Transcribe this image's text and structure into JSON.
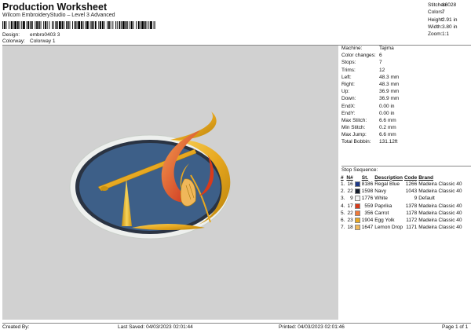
{
  "header": {
    "title": "Production Worksheet",
    "subtitle": "Wilcom EmbroideryStudio – Level 3 Advanced",
    "design_label": "Design:",
    "design_value": "embro0403 3",
    "colorway_label": "Colorway:",
    "colorway_value": "Colorway 1"
  },
  "summary": [
    {
      "label": "Stitches:",
      "value": "16028"
    },
    {
      "label": "Colors:",
      "value": "7"
    },
    {
      "label": "Height:",
      "value": "2.91 in"
    },
    {
      "label": "Width:",
      "value": "3.80 in"
    },
    {
      "label": "Zoom:",
      "value": "1:1"
    }
  ],
  "machine_info": [
    {
      "label": "Machine:",
      "value": "Tajima"
    },
    {
      "label": "Color changes:",
      "value": "6"
    },
    {
      "label": "Stops:",
      "value": "7"
    },
    {
      "label": "Trims:",
      "value": "12"
    },
    {
      "label": "Left:",
      "value": "48.3 mm"
    },
    {
      "label": "Right:",
      "value": "48.3 mm"
    },
    {
      "label": "Up:",
      "value": "36.9 mm"
    },
    {
      "label": "Down:",
      "value": "36.9 mm"
    },
    {
      "label": "EndX:",
      "value": "0.00 in"
    },
    {
      "label": "EndY:",
      "value": "0.00 in"
    },
    {
      "label": "Max Stitch:",
      "value": "6.6 mm"
    },
    {
      "label": "Min Stitch:",
      "value": "0.2 mm"
    },
    {
      "label": "Max Jump:",
      "value": "6.6 mm"
    },
    {
      "label": "Total Bobbin:",
      "value": "131.12ft"
    }
  ],
  "stop_sequence": {
    "title": "Stop Sequence:",
    "headers": [
      "#",
      "N#",
      "",
      "St.",
      "Description",
      "Code",
      "Brand"
    ],
    "rows": [
      {
        "num": "1.",
        "n": "16",
        "color": "#1e3a8a",
        "st": "8186",
        "desc": "Regal Blue",
        "code": "1266",
        "brand": "Madeira Classic 40"
      },
      {
        "num": "2.",
        "n": "22",
        "color": "#151c2c",
        "st": "1598",
        "desc": "Navy",
        "code": "1043",
        "brand": "Madeira Classic 40"
      },
      {
        "num": "3.",
        "n": "9",
        "color": "#f4f4f4",
        "st": "1776",
        "desc": "White",
        "code": "9",
        "brand": "Default"
      },
      {
        "num": "4.",
        "n": "17",
        "color": "#d93a1a",
        "st": "559",
        "desc": "Paprika",
        "code": "1378",
        "brand": "Madeira Classic 40"
      },
      {
        "num": "5.",
        "n": "22",
        "color": "#f07a3a",
        "st": "356",
        "desc": "Carrot",
        "code": "1178",
        "brand": "Madeira Classic 40"
      },
      {
        "num": "6.",
        "n": "23",
        "color": "#e8a820",
        "st": "1904",
        "desc": "Egg Yolk",
        "code": "1172",
        "brand": "Madeira Classic 40"
      },
      {
        "num": "7.",
        "n": "18",
        "color": "#f0b75a",
        "st": "1647",
        "desc": "Lemon Drop",
        "code": "1171",
        "brand": "Madeira Classic 40"
      }
    ]
  },
  "footer": {
    "created": "Created By:",
    "saved": "Last Saved: 04/03/2023 02:01:44",
    "printed": "Printed: 04/03/2023 02:01:46",
    "page": "Page 1 of 1"
  }
}
